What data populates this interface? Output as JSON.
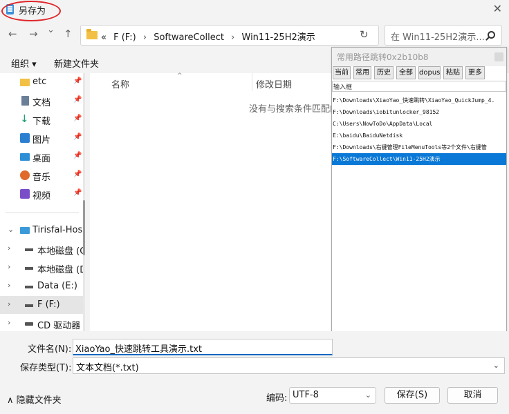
{
  "window": {
    "title": "另存为",
    "close_glyph": "✕"
  },
  "nav": {
    "back": "←",
    "forward": "→",
    "recent": "⌄",
    "up": "↑",
    "address_prefix": "«",
    "path": [
      "F (F:)",
      "SoftwareCollect",
      "Win11-25H2演示"
    ],
    "separator": "›",
    "address_chevron": "⌄",
    "refresh": "↻",
    "search_placeholder": "在 Win11-25H2演示..."
  },
  "toolbar": {
    "organize": "组织 ▾",
    "new_folder": "新建文件夹"
  },
  "sidebar": {
    "quick": [
      {
        "label": "etc",
        "pin": "📌",
        "icon": "folder-icon"
      },
      {
        "label": "文档",
        "pin": "📌",
        "icon": "documents-icon"
      },
      {
        "label": "下载",
        "pin": "📌",
        "icon": "download-icon"
      },
      {
        "label": "图片",
        "pin": "📌",
        "icon": "pictures-icon"
      },
      {
        "label": "桌面",
        "pin": "📌",
        "icon": "desktop-icon"
      },
      {
        "label": "音乐",
        "pin": "📌",
        "icon": "music-icon"
      },
      {
        "label": "视频",
        "pin": "📌",
        "icon": "videos-icon"
      }
    ],
    "tree": [
      {
        "label": "Tirisfal-Hos",
        "chevron": "⌄",
        "icon": "computer-icon"
      },
      {
        "label": "本地磁盘 (C",
        "chevron": "›",
        "icon": "drive-c-icon"
      },
      {
        "label": "本地磁盘 (D",
        "chevron": "›",
        "icon": "drive-icon"
      },
      {
        "label": "Data (E:)",
        "chevron": "›",
        "icon": "drive-icon"
      },
      {
        "label": "F (F:)",
        "chevron": "›",
        "icon": "drive-icon",
        "selected": true
      },
      {
        "label": "CD 驱动器 (",
        "chevron": "›",
        "icon": "cd-drive-icon"
      }
    ]
  },
  "list": {
    "col_name": "名称",
    "col_date": "修改日期",
    "sort_caret": "^",
    "empty_message": "没有与搜索条件匹配的项。"
  },
  "popup": {
    "title": "常用路径跳转0x2b10b8",
    "buttons": [
      "当前",
      "常用",
      "历史",
      "全部",
      "dopus",
      "粘贴",
      "更多"
    ],
    "input_label": "输入框",
    "paths": [
      "F:\\Downloads\\XiaoYao_快速跳转\\XiaoYao_QuickJump_4.",
      "F:\\Downloads\\iobitunlocker_98152",
      "C:\\Users\\NowToDo\\AppData\\Local",
      "E:\\baidu\\BaiduNetdisk",
      "F:\\Downloads\\右键管理FileMenuTools等2个文件\\右键管",
      "F:\\SoftwareCollect\\Win11-25H2演示"
    ],
    "selected_index": 5
  },
  "form": {
    "filename_label": "文件名(N):",
    "filename_value": "XiaoYao_快速跳转工具演示.txt",
    "filetype_label": "保存类型(T):",
    "filetype_value": "文本文档(*.txt)",
    "chevron": "⌄"
  },
  "footer": {
    "hide_folders": "∧ 隐藏文件夹",
    "encoding_label": "编码:",
    "encoding_value": "UTF-8",
    "save": "保存(S)",
    "cancel": "取消"
  },
  "colors": {
    "accent": "#0067c0",
    "selection": "#0a78d6",
    "annotation_circle": "#e0262b"
  }
}
